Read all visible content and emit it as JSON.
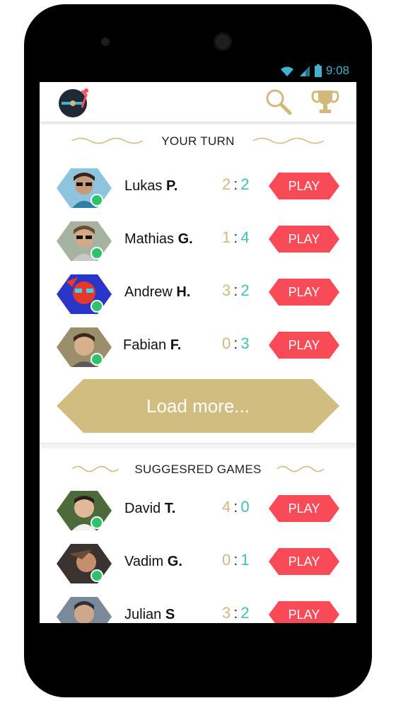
{
  "status": {
    "time": "9:08"
  },
  "colors": {
    "accent_gold": "#d2b97b",
    "play_red": "#f94a57",
    "score_teal": "#3fbfb8",
    "online_green": "#2ec36b"
  },
  "appbar": {
    "logo_icon": "record-player-icon",
    "search_icon": "search-icon",
    "trophy_icon": "trophy-icon"
  },
  "your_turn": {
    "title": "YOUR TURN",
    "rows": [
      {
        "first": "Lukas",
        "last": "P.",
        "score_a": "2",
        "sep": ":",
        "score_b": "2",
        "play": "PLAY"
      },
      {
        "first": "Mathias",
        "last": "G.",
        "score_a": "1",
        "sep": ":",
        "score_b": "4",
        "play": "PLAY"
      },
      {
        "first": "Andrew",
        "last": "H.",
        "score_a": "3",
        "sep": ":",
        "score_b": "2",
        "play": "PLAY"
      },
      {
        "first": "Fabian",
        "last": "F.",
        "score_a": "0",
        "sep": ":",
        "score_b": "3",
        "play": "PLAY"
      }
    ],
    "load_more": "Load more..."
  },
  "suggested": {
    "title": "SUGGESRED GAMES",
    "rows": [
      {
        "first": "David",
        "last": "T.",
        "score_a": "4",
        "sep": ":",
        "score_b": "0",
        "play": "PLAY"
      },
      {
        "first": "Vadim",
        "last": "G.",
        "score_a": "0",
        "sep": ":",
        "score_b": "1",
        "play": "PLAY"
      },
      {
        "first": "Julian",
        "last": "S",
        "score_a": "3",
        "sep": ":",
        "score_b": "2",
        "play": "PLAY"
      }
    ]
  }
}
